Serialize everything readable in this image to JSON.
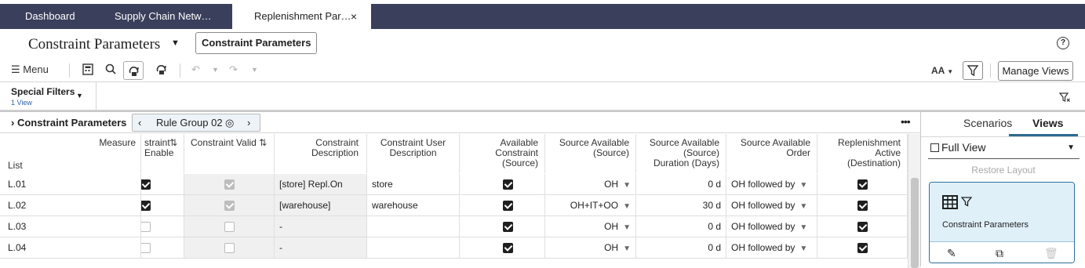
{
  "tabs": [
    {
      "label": "Dashboard"
    },
    {
      "label": "Supply Chain Netw…"
    },
    {
      "label": "Replenishment Par…",
      "close": "×"
    }
  ],
  "title": {
    "page": "Constraint Parameters",
    "button": "Constraint Parameters",
    "help": "?"
  },
  "toolbar": {
    "menu": "Menu",
    "font_size": "AA",
    "manage_views": "Manage Views"
  },
  "filters": {
    "label": "Special Filters",
    "count": "1 View"
  },
  "grid": {
    "title": "Constraint Parameters",
    "rule_group": "Rule Group 02",
    "row_dim_header": "List",
    "measure_header": "Measure",
    "columns": [
      "straint\nEnable",
      "Constraint Valid",
      "Constraint\nDescription",
      "Constraint User\nDescription",
      "Available\nConstraint\n(Source)",
      "Source Available\n(Source)",
      "Source Available\n(Source)\nDuration (Days)",
      "Source Available\nOrder",
      "Replenishment\nActive\n(Destination)"
    ],
    "rows": [
      {
        "id": "L.01",
        "enable": "on",
        "valid": "grey",
        "desc": "[store] Repl.On",
        "user_desc": "store",
        "avail": "on",
        "source": "OH",
        "duration": "0 d",
        "order": "OH followed by",
        "active": "on"
      },
      {
        "id": "L.02",
        "enable": "on",
        "valid": "grey",
        "desc": "[warehouse]",
        "user_desc": "warehouse",
        "avail": "on",
        "source": "OH+IT+OO",
        "duration": "30 d",
        "order": "OH followed by",
        "active": "on"
      },
      {
        "id": "L.03",
        "enable": "off",
        "valid": "off",
        "desc": "-",
        "user_desc": "",
        "avail": "on",
        "source": "OH",
        "duration": "0 d",
        "order": "OH followed by",
        "active": "on"
      },
      {
        "id": "L.04",
        "enable": "off",
        "valid": "off",
        "desc": "-",
        "user_desc": "",
        "avail": "on",
        "source": "OH",
        "duration": "0 d",
        "order": "OH followed by",
        "active": "on"
      }
    ]
  },
  "right_panel": {
    "tab_scenarios": "Scenarios",
    "tab_views": "Views",
    "view_select": "Full View",
    "restore": "Restore Layout",
    "card_name": "Constraint Parameters"
  }
}
